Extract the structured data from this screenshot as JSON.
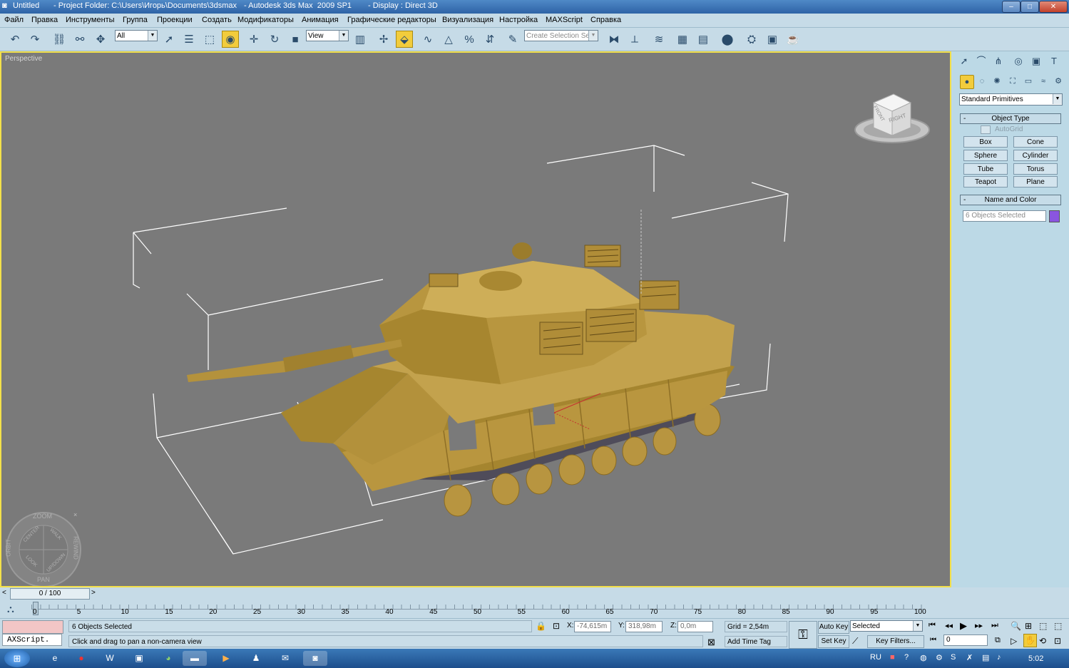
{
  "window": {
    "title_parts": [
      "Untitled",
      "- Project Folder: C:\\Users\\Игорь\\Documents\\3dsmax",
      "- Autodesk 3ds Max  2009 SP1",
      "- Display : Direct 3D"
    ],
    "min": "–",
    "max": "□",
    "close": "✕"
  },
  "menu": [
    "Файл",
    "Правка",
    "Инструменты",
    "Группа",
    "Проекции",
    "Создать",
    "Модификаторы",
    "Анимация",
    "Графические редакторы",
    "Визуализация",
    "Настройка",
    "MAXScript",
    "Справка"
  ],
  "toolbar": {
    "selection_filter": "All",
    "ref_coord": "View",
    "named_selection_placeholder": "Create Selection Set",
    "icons": [
      "undo-icon",
      "redo-icon",
      "select-link-icon",
      "unlink-icon",
      "bind-spacewarp-icon",
      "select-icon",
      "select-by-name-icon",
      "rect-region-icon",
      "window-crossing-icon",
      "move-icon",
      "rotate-icon",
      "scale-icon",
      "pivot-icon",
      "manipulate-icon",
      "keyboard-shortcut-icon",
      "snap-3d-icon",
      "angle-snap-icon",
      "percent-snap-icon",
      "spinner-snap-icon",
      "edit-named-sel-icon",
      "mirror-icon",
      "align-icon",
      "layer-manager-icon",
      "curve-editor-icon",
      "schematic-view-icon",
      "material-editor-icon",
      "render-setup-icon",
      "rendered-frame-icon",
      "quick-render-icon"
    ]
  },
  "viewport": {
    "label": "Perspective",
    "viewcube_face": "RIGHT",
    "viewcube_side": "FRONT",
    "wheel": {
      "top": "ZOOM",
      "bottom": "PAN",
      "left": "ORBIT",
      "right": "REWIND",
      "nw": "CENTER",
      "ne": "WALK",
      "sw": "LOOK",
      "se": "UP/DOWN"
    }
  },
  "command_panel": {
    "category_dropdown": "Standard Primitives",
    "object_type": {
      "title": "Object Type",
      "autogrid": "AutoGrid",
      "buttons": [
        "Box",
        "Cone",
        "Sphere",
        "Cylinder",
        "Tube",
        "Torus",
        "Teapot",
        "Plane"
      ]
    },
    "name_and_color": {
      "title": "Name and Color",
      "name_value": "6 Objects Selected",
      "color": "#8a55e0"
    },
    "collapse": "-"
  },
  "timeline": {
    "frame_display": "0 / 100",
    "ticks": [
      "0",
      "5",
      "10",
      "15",
      "20",
      "25",
      "30",
      "35",
      "40",
      "45",
      "50",
      "55",
      "60",
      "65",
      "70",
      "75",
      "80",
      "85",
      "90",
      "95",
      "100"
    ]
  },
  "status": {
    "maxscript_label": "AXScript.",
    "selection_status": "6 Objects Selected",
    "prompt": "Click and drag to pan a non-camera view",
    "x_label": "X:",
    "x_value": "-74,615m",
    "y_label": "Y:",
    "y_value": "318,98m",
    "z_label": "Z:",
    "z_value": "0,0m",
    "grid": "Grid = 2,54m",
    "add_time_tag": "Add Time Tag",
    "auto_key": "Auto Key",
    "set_key": "Set Key",
    "key_mode": "Selected",
    "key_filters": "Key Filters...",
    "current_frame": "0"
  },
  "taskbar": {
    "lang": "RU",
    "clock": "5:02",
    "apps": [
      "opera-icon",
      "word-icon",
      "outlook-icon",
      "chrome-icon",
      "explorer-icon",
      "media-icon",
      "user-icon",
      "mail-icon",
      "3dsmax-icon"
    ]
  },
  "colors": {
    "viewport_bg": "#7a7a7a",
    "viewport_border": "#f3e04a",
    "tank": "#b6923c",
    "ui_bg": "#bcd9e6"
  }
}
